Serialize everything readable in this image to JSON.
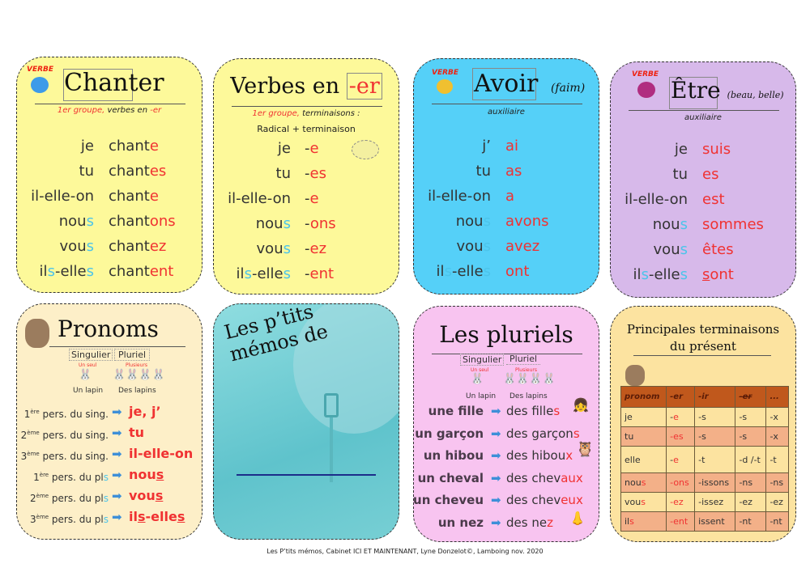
{
  "colors": {
    "yellow": "#fdf99a",
    "blue": "#55d0f8",
    "purple": "#d7b9ea",
    "cream": "#fdefc8",
    "pink": "#f8c4f0",
    "orange": "#fce3a0",
    "red": "#f03232",
    "cyan": "#4cc4ea",
    "table_header": "#c0581c",
    "table_alt": "#f3b088"
  },
  "chanter": {
    "tag": "VERBE",
    "title": "Chanter",
    "subtitle_red": "1er groupe,",
    "subtitle": " verbes en ",
    "subtitle_end": "-er",
    "rows": [
      {
        "p": [
          [
            "je",
            "k"
          ]
        ],
        "v": [
          [
            "chant",
            "k"
          ],
          [
            "e",
            "r"
          ]
        ]
      },
      {
        "p": [
          [
            "tu",
            "k"
          ]
        ],
        "v": [
          [
            "chant",
            "k"
          ],
          [
            "es",
            "r"
          ]
        ]
      },
      {
        "p": [
          [
            "il-elle-on",
            "k"
          ]
        ],
        "v": [
          [
            "chant",
            "k"
          ],
          [
            "e",
            "r"
          ]
        ]
      },
      {
        "p": [
          [
            "nou",
            "k"
          ],
          [
            "s",
            "c"
          ]
        ],
        "v": [
          [
            "chant",
            "k"
          ],
          [
            "ons",
            "r"
          ]
        ]
      },
      {
        "p": [
          [
            "vou",
            "k"
          ],
          [
            "s",
            "c"
          ]
        ],
        "v": [
          [
            "chant",
            "k"
          ],
          [
            "ez",
            "r"
          ]
        ]
      },
      {
        "p": [
          [
            "il",
            "k"
          ],
          [
            "s",
            "c"
          ],
          [
            "-elle",
            "k"
          ],
          [
            "s",
            "c"
          ]
        ],
        "v": [
          [
            "chant",
            "k"
          ],
          [
            "ent",
            "r"
          ]
        ]
      }
    ]
  },
  "verbes_er": {
    "title": "Verbes en ",
    "title_box": "-er",
    "subtitle_red": "1er groupe,",
    "subtitle": " terminaisons :",
    "formula": "Radical  +  terminaison",
    "rows": [
      {
        "p": [
          [
            "je",
            "k"
          ]
        ],
        "v": [
          [
            "-",
            "k"
          ],
          [
            "e",
            "r"
          ]
        ]
      },
      {
        "p": [
          [
            "tu",
            "k"
          ]
        ],
        "v": [
          [
            "-",
            "k"
          ],
          [
            "es",
            "r"
          ]
        ]
      },
      {
        "p": [
          [
            "il-elle-on",
            "k"
          ]
        ],
        "v": [
          [
            "-",
            "k"
          ],
          [
            "e",
            "r"
          ]
        ]
      },
      {
        "p": [
          [
            "nou",
            "k"
          ],
          [
            "s",
            "c"
          ]
        ],
        "v": [
          [
            "-",
            "k"
          ],
          [
            "ons",
            "r"
          ]
        ]
      },
      {
        "p": [
          [
            "vou",
            "k"
          ],
          [
            "s",
            "c"
          ]
        ],
        "v": [
          [
            "-",
            "k"
          ],
          [
            "ez",
            "r"
          ]
        ]
      },
      {
        "p": [
          [
            "il",
            "k"
          ],
          [
            "s",
            "c"
          ],
          [
            "-elle",
            "k"
          ],
          [
            "s",
            "c"
          ]
        ],
        "v": [
          [
            "-",
            "k"
          ],
          [
            "ent",
            "r"
          ]
        ]
      }
    ]
  },
  "avoir": {
    "tag": "VERBE",
    "title": "Avoir",
    "note": "(faim)",
    "subtitle": "auxiliaire",
    "rows": [
      {
        "p": [
          [
            "j’",
            "k"
          ]
        ],
        "v": [
          [
            "ai",
            "r"
          ]
        ]
      },
      {
        "p": [
          [
            "tu",
            "k"
          ]
        ],
        "v": [
          [
            "as",
            "r"
          ]
        ]
      },
      {
        "p": [
          [
            "il-elle-on",
            "k"
          ]
        ],
        "v": [
          [
            "a",
            "r"
          ]
        ]
      },
      {
        "p": [
          [
            "nou",
            "k"
          ],
          [
            "s",
            "c"
          ]
        ],
        "v": [
          [
            "avons",
            "r"
          ]
        ]
      },
      {
        "p": [
          [
            "vou",
            "k"
          ],
          [
            "s",
            "c"
          ]
        ],
        "v": [
          [
            "avez",
            "r"
          ]
        ]
      },
      {
        "p": [
          [
            "il",
            "k"
          ],
          [
            "s",
            "c"
          ],
          [
            "-elle",
            "k"
          ],
          [
            "s",
            "c"
          ]
        ],
        "v": [
          [
            "ont",
            "r"
          ]
        ]
      }
    ]
  },
  "etre": {
    "tag": "VERBE",
    "title": "Être",
    "note": "(beau, belle)",
    "subtitle": "auxiliaire",
    "rows": [
      {
        "p": [
          [
            "je",
            "k"
          ]
        ],
        "v": [
          [
            "suis",
            "r"
          ]
        ]
      },
      {
        "p": [
          [
            "tu",
            "k"
          ]
        ],
        "v": [
          [
            "es",
            "r"
          ]
        ]
      },
      {
        "p": [
          [
            "il-elle-on",
            "k"
          ]
        ],
        "v": [
          [
            "est",
            "r"
          ]
        ]
      },
      {
        "p": [
          [
            "nou",
            "k"
          ],
          [
            "s",
            "c"
          ]
        ],
        "v": [
          [
            "sommes",
            "r"
          ]
        ]
      },
      {
        "p": [
          [
            "vou",
            "k"
          ],
          [
            "s",
            "c"
          ]
        ],
        "v": [
          [
            "êtes",
            "r"
          ]
        ]
      },
      {
        "p": [
          [
            "il",
            "k"
          ],
          [
            "s",
            "c"
          ],
          [
            "-elle",
            "k"
          ],
          [
            "s",
            "c"
          ]
        ],
        "v": [
          [
            "s",
            "ru"
          ],
          [
            "ont",
            "r"
          ]
        ]
      }
    ]
  },
  "pronoms": {
    "title": "Pronoms",
    "singular": "Singulier",
    "plural": "Pluriel",
    "one": "Un seul",
    "many": "Plusieurs",
    "one_label": "Un lapin",
    "many_label": "Des lapins",
    "rows": [
      {
        "num": "1",
        "sup": "ère",
        "label": " pers. du sing.",
        "s": "",
        "v": [
          [
            "je, j’",
            "r"
          ]
        ]
      },
      {
        "num": "2",
        "sup": "ème",
        "label": " pers. du sing.",
        "s": "",
        "v": [
          [
            "tu",
            "r"
          ]
        ]
      },
      {
        "num": "3",
        "sup": "ème",
        "label": " pers. du sing.",
        "s": "",
        "v": [
          [
            "il-elle-on",
            "r"
          ]
        ]
      },
      {
        "num": "1",
        "sup": "ère",
        "label": " pers. du pl",
        "s": "s",
        "v": [
          [
            "nou",
            "r"
          ],
          [
            "s",
            "ru"
          ]
        ]
      },
      {
        "num": "2",
        "sup": "ème",
        "label": " pers. du pl",
        "s": "s",
        "v": [
          [
            "vou",
            "r"
          ],
          [
            "s",
            "ru"
          ]
        ]
      },
      {
        "num": "3",
        "sup": "ème",
        "label": " pers. du pl",
        "s": "s",
        "v": [
          [
            "il",
            "r"
          ],
          [
            "s",
            "ru"
          ],
          [
            "-elle",
            "r"
          ],
          [
            "s",
            "ru"
          ]
        ]
      }
    ]
  },
  "memos": {
    "title_line1": "Les p’tits",
    "title_line2": "mémos de"
  },
  "pluriels": {
    "title": "Les pluriels",
    "singular": "Singulier",
    "plural": "Pluriel",
    "one": "Un seul",
    "many": "Plusieurs",
    "one_label": "Un lapin",
    "many_label": "Des lapins",
    "rows": [
      {
        "sg": "une fille",
        "v": [
          [
            "des fille",
            "k"
          ],
          [
            "s",
            "r"
          ]
        ]
      },
      {
        "sg": "un garçon",
        "v": [
          [
            "des garçon",
            "k"
          ],
          [
            "s",
            "r"
          ]
        ]
      },
      {
        "sg": "un hibou",
        "v": [
          [
            "des hibou",
            "k"
          ],
          [
            "x",
            "r"
          ]
        ]
      },
      {
        "sg": "un cheval",
        "v": [
          [
            "des chev",
            "k"
          ],
          [
            "aux",
            "r"
          ]
        ]
      },
      {
        "sg": "un cheveu",
        "v": [
          [
            "des chev",
            "k"
          ],
          [
            "eux",
            "r"
          ]
        ]
      },
      {
        "sg": "un nez",
        "v": [
          [
            "des ne",
            "k"
          ],
          [
            "z",
            "r"
          ]
        ]
      }
    ]
  },
  "terminaisons": {
    "title_line1": "Principales terminaisons",
    "title_line2": "du présent",
    "headers": [
      "pronom",
      "-er",
      "-ir",
      "-er",
      "..."
    ],
    "rows": [
      [
        [
          [
            "je",
            "k"
          ]
        ],
        [
          [
            "-",
            "k"
          ],
          [
            "e",
            "r"
          ]
        ],
        [
          [
            "-s",
            "k"
          ]
        ],
        [
          [
            "-s",
            "k"
          ]
        ],
        [
          [
            "-x",
            "k"
          ]
        ]
      ],
      [
        [
          [
            "tu",
            "k"
          ]
        ],
        [
          [
            "-",
            "r"
          ],
          [
            "es",
            "r"
          ]
        ],
        [
          [
            "-s",
            "k"
          ]
        ],
        [
          [
            "-s",
            "k"
          ]
        ],
        [
          [
            "-x",
            "k"
          ]
        ]
      ],
      [
        [
          [
            "elle",
            "k"
          ]
        ],
        [
          [
            "-",
            "k"
          ],
          [
            "e",
            "r"
          ]
        ],
        [
          [
            "-t",
            "k"
          ]
        ],
        [
          [
            "-d /-t",
            "k"
          ]
        ],
        [
          [
            "-t",
            "k"
          ]
        ]
      ],
      [
        [
          [
            "nou",
            "k"
          ],
          [
            "s",
            "r"
          ]
        ],
        [
          [
            "-ons",
            "r"
          ]
        ],
        [
          [
            "-issons",
            "k"
          ]
        ],
        [
          [
            "-ns",
            "k"
          ]
        ],
        [
          [
            "-ns",
            "k"
          ]
        ]
      ],
      [
        [
          [
            "vou",
            "k"
          ],
          [
            "s",
            "r"
          ]
        ],
        [
          [
            "-ez",
            "r"
          ]
        ],
        [
          [
            "-issez",
            "k"
          ]
        ],
        [
          [
            "-ez",
            "k"
          ]
        ],
        [
          [
            "-ez",
            "k"
          ]
        ]
      ],
      [
        [
          [
            "il",
            "k"
          ],
          [
            "s",
            "r"
          ]
        ],
        [
          [
            "-ent",
            "r"
          ]
        ],
        [
          [
            "issent",
            "k"
          ]
        ],
        [
          [
            "-nt",
            "k"
          ]
        ],
        [
          [
            "-nt",
            "k"
          ]
        ]
      ]
    ]
  },
  "footer": "Les P’tits mémos, Cabinet ICI ET MAINTENANT, Lyne Donzelot©, Lamboing nov. 2020"
}
